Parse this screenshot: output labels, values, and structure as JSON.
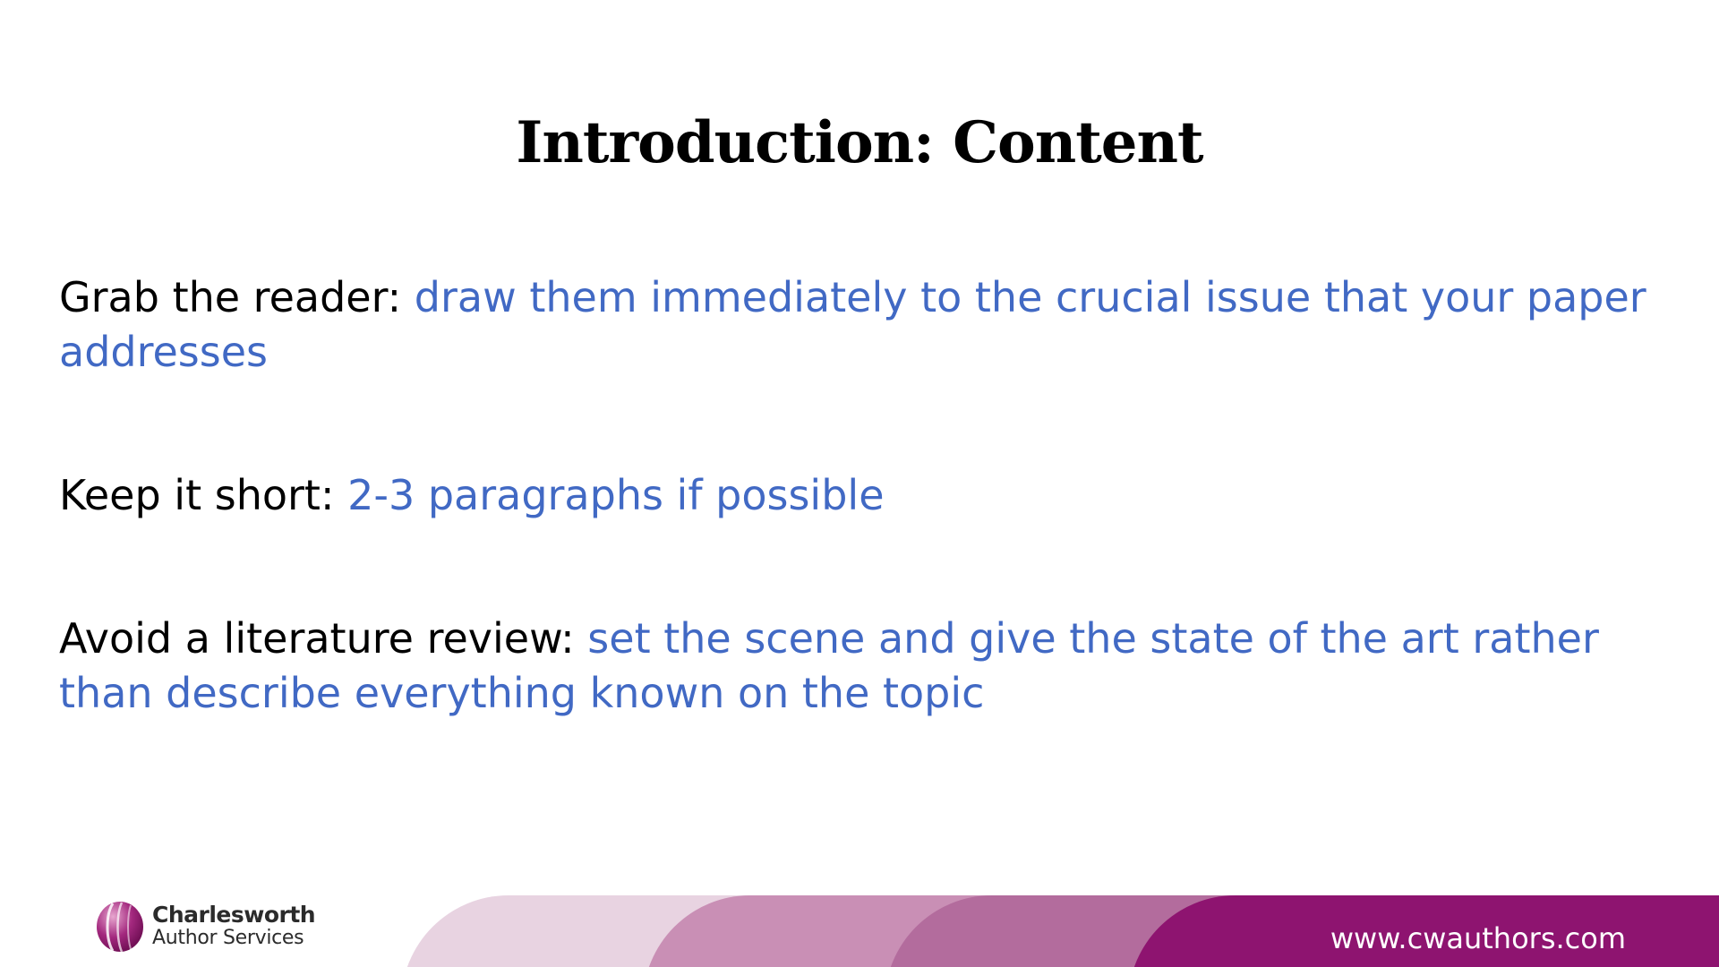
{
  "slide": {
    "title": "Introduction: Content",
    "bullets": [
      {
        "lead": "Grab the reader: ",
        "detail": "draw them immediately to the crucial issue that your paper addresses"
      },
      {
        "lead": "Keep it short: ",
        "detail": "2-3 paragraphs if possible"
      },
      {
        "lead": "Avoid a literature review: ",
        "detail": "set the scene and give the state of the art rather than describe everything known on the topic"
      }
    ]
  },
  "footer": {
    "logo_name": "Charlesworth",
    "logo_subtitle": "Author Services",
    "logo_icon": "charlesworth-globe-icon",
    "url": "www.cwauthors.com"
  },
  "colors": {
    "lead_text": "#000000",
    "detail_text": "#4169c4",
    "band_light": "#e8d3e1",
    "band_mid": "#c98fb5",
    "band_dark": "#b36c9d",
    "band_brand": "#8e1470"
  }
}
